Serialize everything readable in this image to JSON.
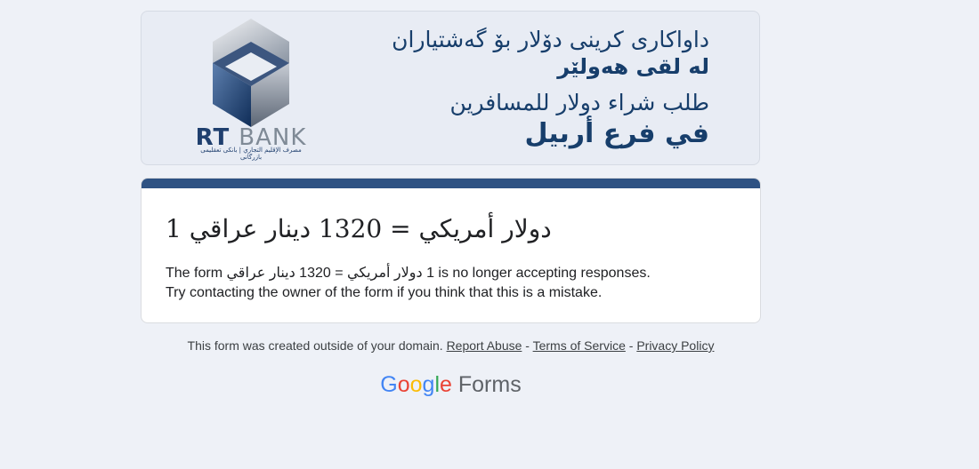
{
  "banner": {
    "brand_rt": "RT",
    "brand_bank": "BANK",
    "brand_sub": "مصرف الإقليم التجاري | بانكى تعقليمى بازرگانى",
    "line1": "داواكارى كرينى دۆلار بۆ گەشتياران",
    "line2": "لە لقى هەولێر",
    "line3": "طلب شراء دولار للمسافرين",
    "line4": "في فرع أربيل"
  },
  "card": {
    "title": "1 دولار أمريكي = 1320 دينار عراقي",
    "msg_prefix": "The form",
    "msg_form_name": "1 دولار أمريكي = 1320 دينار عراقي",
    "msg_suffix": "is no longer accepting responses.",
    "msg_line2": "Try contacting the owner of the form if you think that this is a mistake."
  },
  "footer": {
    "note": "This form was created outside of your domain.",
    "report_abuse": "Report Abuse",
    "sep": "-",
    "terms": "Terms of Service",
    "privacy": "Privacy Policy"
  },
  "branding": {
    "google": "Google",
    "forms": "Forms"
  },
  "colors": {
    "accent": "#2e5283",
    "banner_text": "#173e6b",
    "background": "#eef1f7"
  }
}
